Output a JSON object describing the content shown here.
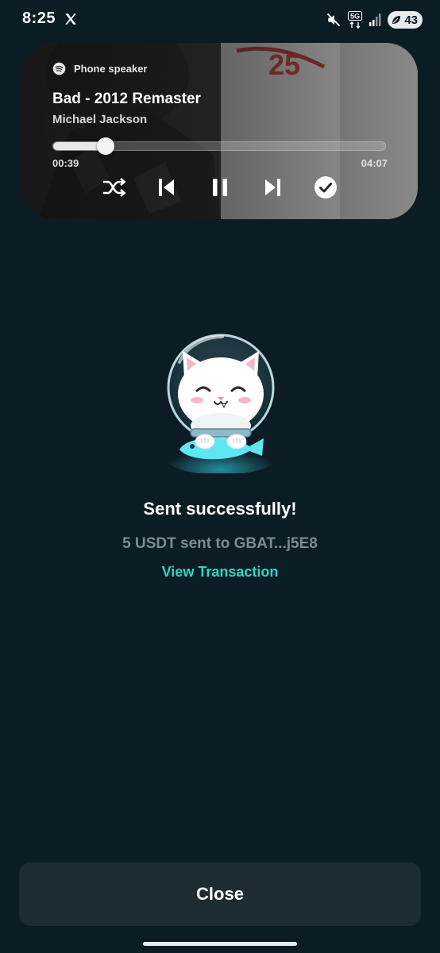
{
  "status_bar": {
    "time": "8:25",
    "battery_level": "43",
    "network": "5G",
    "icons": [
      "x-app-icon",
      "mute-icon",
      "network-5g-icon",
      "signal-icon",
      "battery-saver-icon"
    ]
  },
  "player": {
    "output_device": "Phone speaker",
    "track_title": "Bad - 2012 Remaster",
    "artist": "Michael Jackson",
    "elapsed": "00:39",
    "duration": "04:07",
    "progress": 0.158,
    "icons": [
      "spotify-icon",
      "shuffle-icon",
      "previous-icon",
      "pause-icon",
      "next-icon",
      "saved-check-icon"
    ],
    "art_text": "25"
  },
  "result": {
    "title": "Sent successfully!",
    "detail": "5 USDT sent to GBAT...j5E8",
    "link_label": "View Transaction"
  },
  "footer": {
    "close_label": "Close"
  },
  "colors": {
    "background": "#0c1c24",
    "accent": "#2ad8c4",
    "muted_text": "#7e8a91",
    "button_bg": "#1d2c33"
  }
}
